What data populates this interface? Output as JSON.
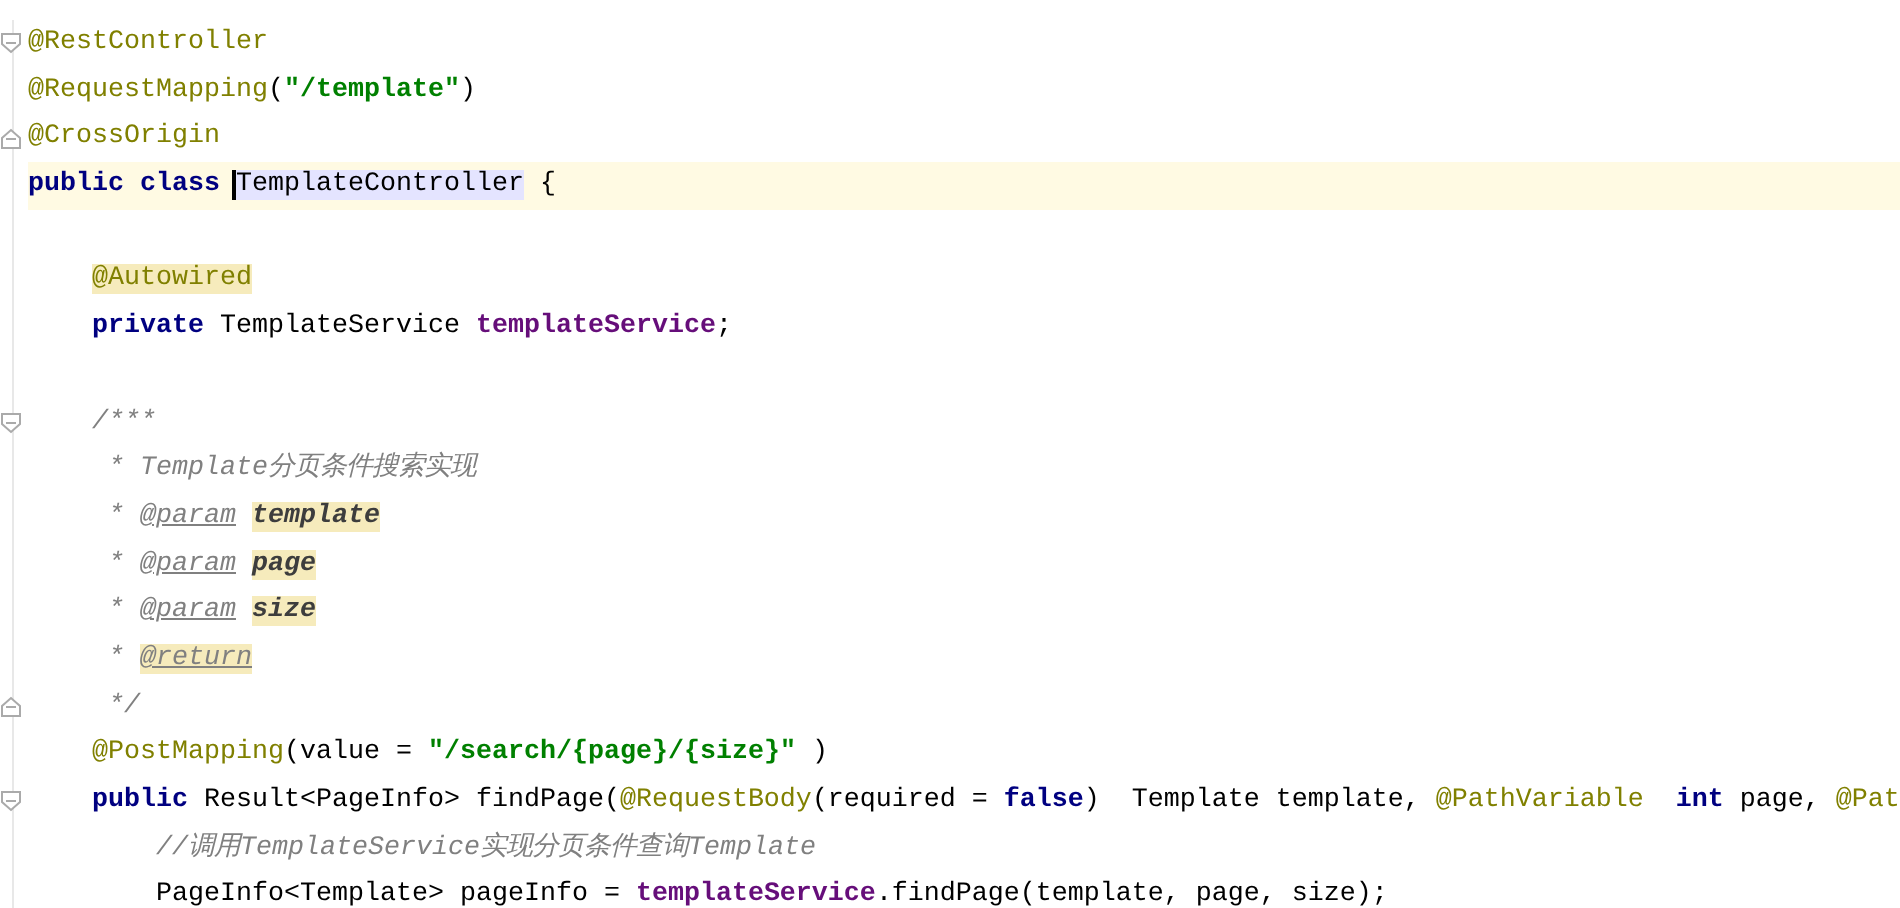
{
  "editor": {
    "lines": [
      {
        "fold": {
          "kind": "start"
        },
        "current": false,
        "tokens": [
          {
            "kind": "annotation",
            "text": "@RestController"
          }
        ]
      },
      {
        "current": false,
        "tokens": [
          {
            "kind": "annotation",
            "text": "@RequestMapping"
          },
          {
            "kind": "plain",
            "text": "("
          },
          {
            "kind": "string",
            "text": "\"/template\""
          },
          {
            "kind": "plain",
            "text": ")"
          }
        ]
      },
      {
        "fold": {
          "kind": "end"
        },
        "current": false,
        "tokens": [
          {
            "kind": "annotation",
            "text": "@CrossOrigin"
          }
        ]
      },
      {
        "current": true,
        "tokens": [
          {
            "kind": "keyword",
            "text": "public class "
          },
          {
            "kind": "plain",
            "text": "TemplateController",
            "selected": true,
            "caret": true
          },
          {
            "kind": "plain",
            "text": " {"
          }
        ]
      },
      {
        "current": false
      },
      {
        "current": false,
        "tokens": [
          {
            "kind": "annotation",
            "text": "    @Autowired",
            "highlighted": true
          }
        ]
      },
      {
        "current": false,
        "tokens": [
          {
            "kind": "keyword",
            "text": "    private "
          },
          {
            "kind": "plain",
            "text": "TemplateService "
          },
          {
            "kind": "field",
            "text": "templateService"
          },
          {
            "kind": "plain",
            "text": ";"
          }
        ]
      },
      {
        "current": false
      },
      {
        "fold": {
          "kind": "start"
        },
        "current": false,
        "tokens": [
          {
            "kind": "comment",
            "text": "    /***"
          }
        ]
      },
      {
        "current": false,
        "tokens": [
          {
            "kind": "comment",
            "text": "     * Template分页条件搜索实现"
          }
        ]
      },
      {
        "current": false,
        "tokens": [
          {
            "kind": "comment",
            "text": "     * "
          },
          {
            "kind": "doctag",
            "text": "@param "
          },
          {
            "kind": "docparam",
            "text": "template",
            "highlighted": true
          }
        ]
      },
      {
        "current": false,
        "tokens": [
          {
            "kind": "comment",
            "text": "     * "
          },
          {
            "kind": "doctag",
            "text": "@param "
          },
          {
            "kind": "docparam",
            "text": "page",
            "highlighted": true
          }
        ]
      },
      {
        "current": false,
        "tokens": [
          {
            "kind": "comment",
            "text": "     * "
          },
          {
            "kind": "doctag",
            "text": "@param "
          },
          {
            "kind": "docparam",
            "text": "size",
            "highlighted": true
          }
        ]
      },
      {
        "current": false,
        "tokens": [
          {
            "kind": "comment",
            "text": "     * "
          },
          {
            "kind": "doctag",
            "text": "@return",
            "highlighted": true
          }
        ]
      },
      {
        "fold": {
          "kind": "end"
        },
        "current": false,
        "tokens": [
          {
            "kind": "comment",
            "text": "     */"
          }
        ]
      },
      {
        "current": false,
        "tokens": [
          {
            "kind": "annotation",
            "text": "    @PostMapping"
          },
          {
            "kind": "plain",
            "text": "(value = "
          },
          {
            "kind": "string",
            "text": "\"/search/{page}/{size}\""
          },
          {
            "kind": "plain",
            "text": " )"
          }
        ]
      },
      {
        "fold": {
          "kind": "start"
        },
        "current": false,
        "tokens": [
          {
            "kind": "keyword",
            "text": "    public "
          },
          {
            "kind": "plain",
            "text": "Result<PageInfo> findPage("
          },
          {
            "kind": "annotation",
            "text": "@RequestBody"
          },
          {
            "kind": "plain",
            "text": "(required = "
          },
          {
            "kind": "keyword",
            "text": "false"
          },
          {
            "kind": "plain",
            "text": ")  Template template, "
          },
          {
            "kind": "annotation",
            "text": "@PathVariable"
          },
          {
            "kind": "keyword",
            "text": "  int "
          },
          {
            "kind": "plain",
            "text": "page, "
          },
          {
            "kind": "annotation",
            "text": "@Pat"
          }
        ]
      },
      {
        "current": false,
        "tokens": [
          {
            "kind": "comment",
            "text": "        //调用TemplateService实现分页条件查询Template"
          }
        ]
      },
      {
        "current": false,
        "tokens": [
          {
            "kind": "plain",
            "text": "        PageInfo<Template> pageInfo = "
          },
          {
            "kind": "field",
            "text": "templateService"
          },
          {
            "kind": "plain",
            "text": ".findPage(template, page, size);"
          }
        ]
      }
    ]
  }
}
